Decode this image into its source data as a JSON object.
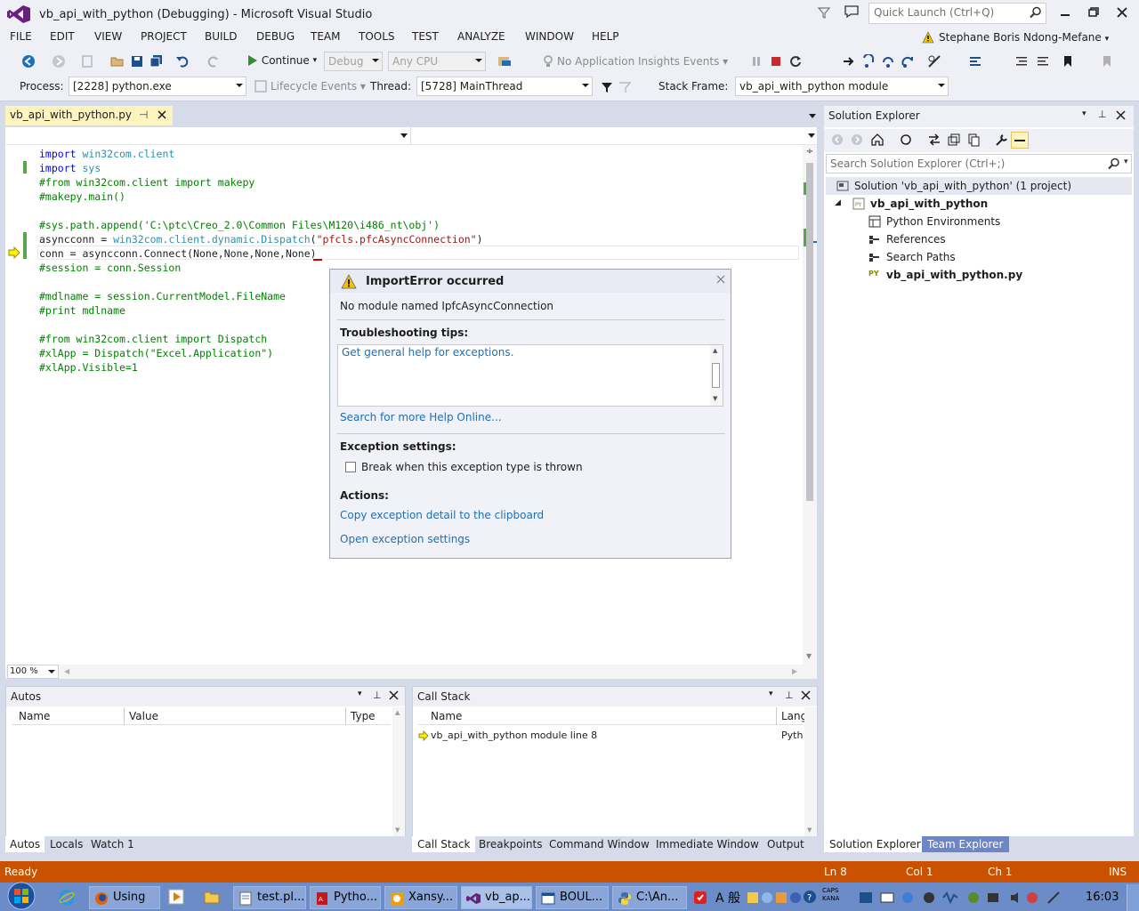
{
  "window": {
    "title": "vb_api_with_python (Debugging) - Microsoft Visual Studio",
    "quick_launch_placeholder": "Quick Launch (Ctrl+Q)",
    "user": "Stephane Boris Ndong-Mefane"
  },
  "menu": [
    "FILE",
    "EDIT",
    "VIEW",
    "PROJECT",
    "BUILD",
    "DEBUG",
    "TEAM",
    "TOOLS",
    "TEST",
    "ANALYZE",
    "WINDOW",
    "HELP"
  ],
  "toolbar": {
    "continue_label": "Continue",
    "config": "Debug",
    "platform": "Any CPU",
    "app_insights": "No Application Insights Events"
  },
  "debug_location": {
    "process_label": "Process:",
    "process": "[2228] python.exe",
    "lifecycle_label": "Lifecycle Events",
    "thread_label": "Thread:",
    "thread": "[5728] MainThread",
    "stack_frame_label": "Stack Frame:",
    "stack_frame": "vb_api_with_python module"
  },
  "editor": {
    "tab_title": "vb_api_with_python.py",
    "zoom": "100 %",
    "lines": [
      {
        "parts": [
          {
            "c": "kw",
            "t": "import"
          },
          {
            "c": "id",
            "t": " win32com.client"
          }
        ]
      },
      {
        "parts": [
          {
            "c": "kw",
            "t": "import"
          },
          {
            "c": "id",
            "t": " sys"
          }
        ]
      },
      {
        "parts": [
          {
            "c": "cm",
            "t": "#from win32com.client import makepy"
          }
        ]
      },
      {
        "parts": [
          {
            "c": "cm",
            "t": "#makepy.main()"
          }
        ]
      },
      {
        "parts": [
          {
            "c": "",
            "t": ""
          }
        ]
      },
      {
        "parts": [
          {
            "c": "cm",
            "t": "#sys.path.append('C:\\ptc\\Creo_2.0\\Common Files\\M120\\i486_nt\\obj')"
          }
        ]
      },
      {
        "parts": [
          {
            "c": "",
            "t": "asyncconn = "
          },
          {
            "c": "id",
            "t": "win32com.client.dynamic.Dispatch"
          },
          {
            "c": "",
            "t": "("
          },
          {
            "c": "st",
            "t": "\"pfcls.pfcAsyncConnection\""
          },
          {
            "c": "",
            "t": ")"
          }
        ]
      },
      {
        "parts": [
          {
            "c": "",
            "t": "conn = asyncconn.Connect(None,None,None,None)"
          }
        ]
      },
      {
        "parts": [
          {
            "c": "cm",
            "t": "#session = conn.Session"
          }
        ]
      },
      {
        "parts": [
          {
            "c": "",
            "t": ""
          }
        ]
      },
      {
        "parts": [
          {
            "c": "cm",
            "t": "#mdlname = session.CurrentModel.FileName"
          }
        ]
      },
      {
        "parts": [
          {
            "c": "cm",
            "t": "#print mdlname"
          }
        ]
      },
      {
        "parts": [
          {
            "c": "",
            "t": ""
          }
        ]
      },
      {
        "parts": [
          {
            "c": "cm",
            "t": "#from win32com.client import Dispatch"
          }
        ]
      },
      {
        "parts": [
          {
            "c": "cm",
            "t": "#xlApp = Dispatch(\"Excel.Application\")"
          }
        ]
      },
      {
        "parts": [
          {
            "c": "cm",
            "t": "#xlApp.Visible=1"
          }
        ]
      }
    ]
  },
  "exception_popup": {
    "title": "ImportError occurred",
    "message": "No module named IpfcAsyncConnection",
    "troubleshooting_heading": "Troubleshooting tips:",
    "tip_link": "Get general help for exceptions.",
    "search_link": "Search for more Help Online...",
    "exception_settings_heading": "Exception settings:",
    "break_checkbox": "Break when this exception type is thrown",
    "actions_heading": "Actions:",
    "copy_link": "Copy exception detail to the clipboard",
    "open_settings_link": "Open exception settings"
  },
  "autos": {
    "title": "Autos",
    "columns": [
      "Name",
      "Value",
      "Type"
    ],
    "tabs": [
      "Autos",
      "Locals",
      "Watch 1"
    ]
  },
  "callstack": {
    "title": "Call Stack",
    "columns": [
      "Name",
      "Lang"
    ],
    "rows": [
      {
        "name": "vb_api_with_python module line 8",
        "lang": "Pyth"
      }
    ],
    "tabs": [
      "Call Stack",
      "Breakpoints",
      "Command Window",
      "Immediate Window",
      "Output"
    ]
  },
  "solution_explorer": {
    "title": "Solution Explorer",
    "search_placeholder": "Search Solution Explorer (Ctrl+;)",
    "solution": "Solution 'vb_api_with_python' (1 project)",
    "project": "vb_api_with_python",
    "items": [
      "Python Environments",
      "References",
      "Search Paths",
      "vb_api_with_python.py"
    ],
    "tabs": [
      "Solution Explorer",
      "Team Explorer"
    ]
  },
  "status": {
    "state": "Ready",
    "ln": "Ln 8",
    "col": "Col 1",
    "ch": "Ch 1",
    "mode": "INS"
  },
  "taskbar": {
    "items": [
      "Using ...",
      "test.pl...",
      "Pytho...",
      "Xansy...",
      "vb_ap...",
      "BOUL...",
      "C:\\An..."
    ],
    "clock": "16:03",
    "ime": "A 般",
    "caps": "CAPS",
    "kana": "KANA"
  }
}
